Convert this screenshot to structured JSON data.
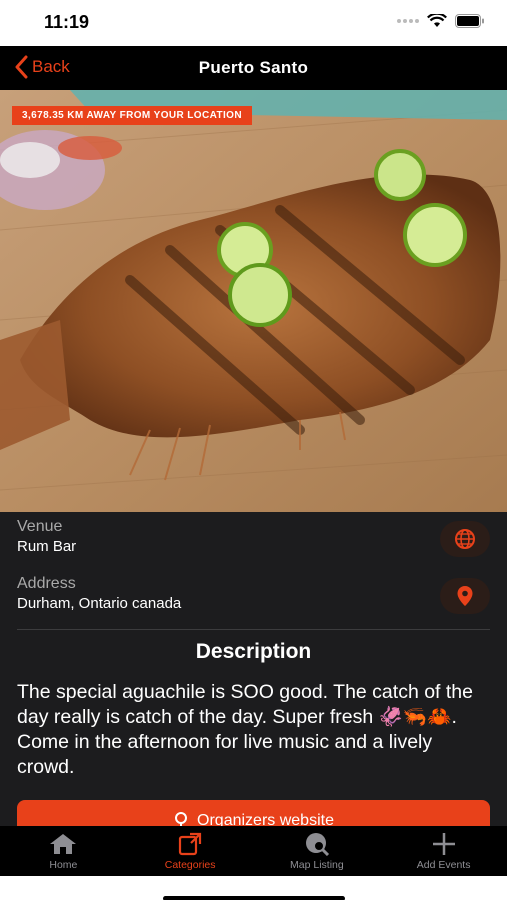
{
  "status_bar": {
    "time": "11:19"
  },
  "nav": {
    "back_label": "Back",
    "title": "Puerto Santo"
  },
  "hero": {
    "distance_badge": "3,678.35 KM AWAY FROM YOUR LOCATION",
    "image_desc": "grilled-fish-on-wooden-board"
  },
  "venue": {
    "label": "Venue",
    "value": "Rum Bar",
    "action_icon": "globe-icon"
  },
  "address": {
    "label": "Address",
    "value": "Durham, Ontario canada",
    "action_icon": "map-pin-icon"
  },
  "description": {
    "title": "Description",
    "text": "The special aguachile is SOO good. The catch of the day really is catch of the day. Super fresh 🦑🦐🦀. Come in the afternoon for live music and a lively crowd."
  },
  "organizer_button": {
    "label": "Organizers website"
  },
  "tab_bar": {
    "items": [
      {
        "label": "Home",
        "icon": "home-icon",
        "active": false
      },
      {
        "label": "Categories",
        "icon": "categories-icon",
        "active": true
      },
      {
        "label": "Map Listing",
        "icon": "map-search-icon",
        "active": false
      },
      {
        "label": "Add Events",
        "icon": "plus-icon",
        "active": false
      }
    ]
  },
  "colors": {
    "accent": "#e8411a",
    "panel": "#1c1c1e",
    "nav": "#000000"
  }
}
